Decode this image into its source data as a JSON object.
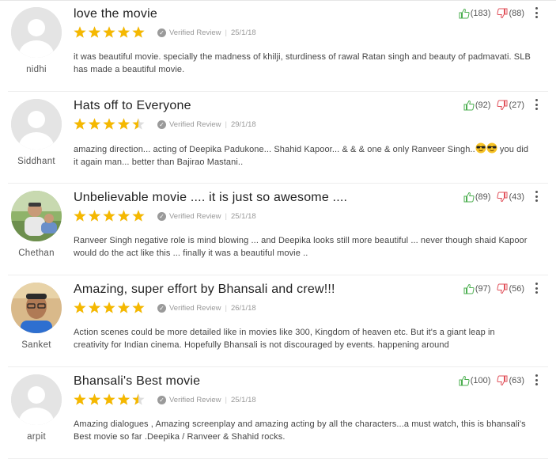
{
  "reviews": [
    {
      "user": "nidhi",
      "avatar": "default",
      "title": "love the movie",
      "rating": 5,
      "badge": "Verified Review",
      "date": "25/1/18",
      "body": "it was beautiful movie. specially the madness of khilji, sturdiness of rawal Ratan singh and beauty of padmavati. SLB has made a beautiful movie.",
      "likes": "(183)",
      "dislikes": "(88)"
    },
    {
      "user": "Siddhant",
      "avatar": "default",
      "title": "Hats off to Everyone",
      "rating": 4.5,
      "badge": "Verified Review",
      "date": "29/1/18",
      "body_before": "amazing direction... acting of Deepika Padukone... Shahid Kapoor... & & & one & only Ranveer Singh..",
      "body_emojis": [
        "sunglasses-emoji",
        "sunglasses-emoji"
      ],
      "body_after": " you did it again man... better than Bajirao Mastani..",
      "likes": "(92)",
      "dislikes": "(27)"
    },
    {
      "user": "Chethan",
      "avatar": "photo-outdoor",
      "title": "Unbelievable movie .... it is just so awesome ....",
      "rating": 5,
      "badge": "Verified Review",
      "date": "25/1/18",
      "body": "Ranveer Singh negative role is mind blowing ... and Deepika looks still more beautiful ... never though shaid Kapoor would do the act like this ... finally it was a beautiful movie ..",
      "likes": "(89)",
      "dislikes": "(43)"
    },
    {
      "user": "Sanket",
      "avatar": "photo-portrait",
      "title": "Amazing, super effort by Bhansali and crew!!!",
      "rating": 5,
      "badge": "Verified Review",
      "date": "26/1/18",
      "body": "Action scenes could be more detailed like in movies like 300, Kingdom of heaven etc. But it's a giant leap in creativity for Indian cinema. Hopefully Bhansali is not discouraged by events. happening around",
      "likes": "(97)",
      "dislikes": "(56)"
    },
    {
      "user": "arpit",
      "avatar": "default",
      "title": "Bhansali's Best movie",
      "rating": 4.5,
      "badge": "Verified Review",
      "date": "25/1/18",
      "body": "Amazing dialogues , Amazing screenplay and amazing acting by all the characters...a must watch, this is bhansali's Best movie so far .Deepika / Ranveer & Shahid rocks.",
      "likes": "(100)",
      "dislikes": "(63)"
    }
  ],
  "colors": {
    "star": "#f5b800",
    "like": "#4caf50",
    "dislike": "#e0505a",
    "badge": "#9a9a9a"
  }
}
